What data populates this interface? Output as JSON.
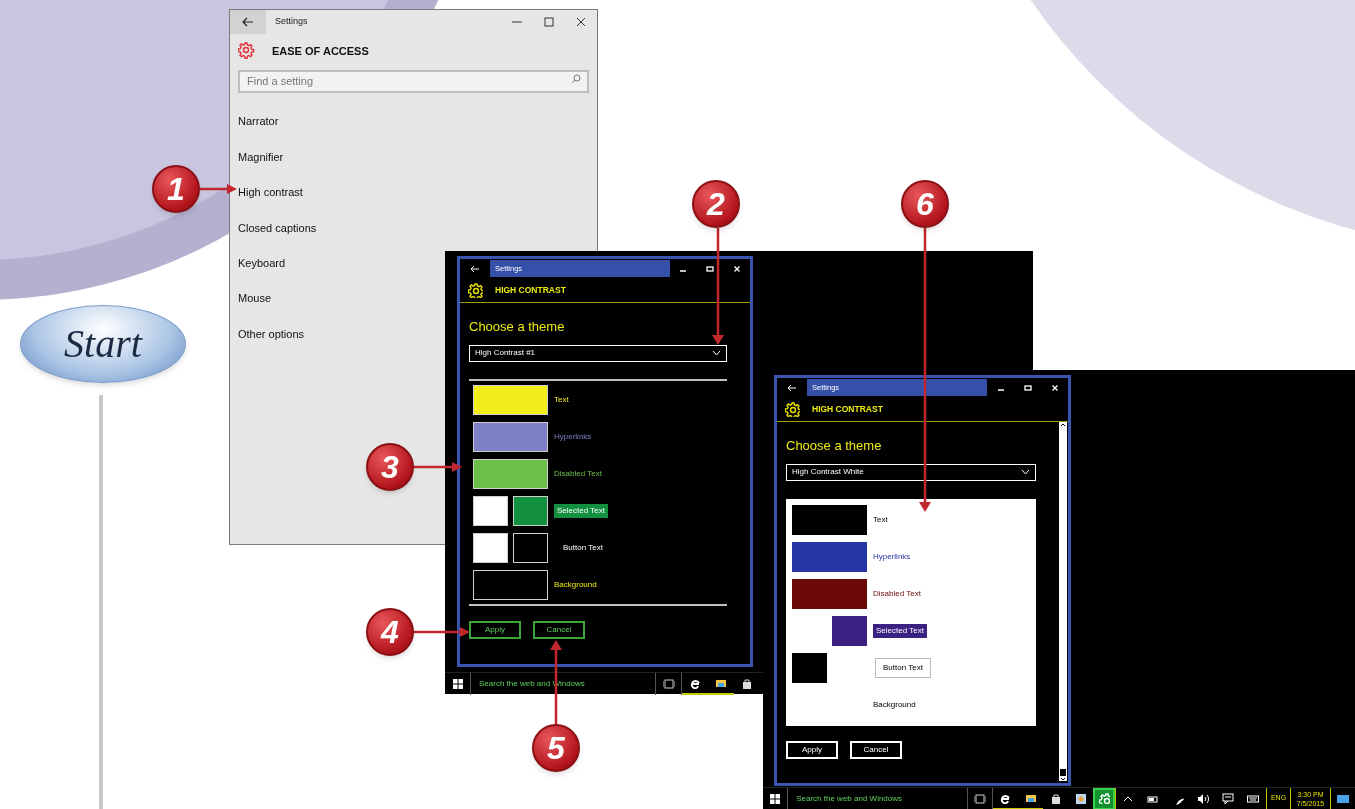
{
  "start_badge": {
    "label": "Start"
  },
  "callouts": [
    {
      "label": "1"
    },
    {
      "label": "2"
    },
    {
      "label": "3"
    },
    {
      "label": "4"
    },
    {
      "label": "5"
    },
    {
      "label": "6"
    }
  ],
  "settings_window": {
    "title": "Settings",
    "header": "EASE OF ACCESS",
    "search": {
      "placeholder": "Find a setting"
    },
    "items": [
      {
        "label": "Narrator"
      },
      {
        "label": "Magnifier"
      },
      {
        "label": "High contrast"
      },
      {
        "label": "Closed captions"
      },
      {
        "label": "Keyboard"
      },
      {
        "label": "Mouse"
      },
      {
        "label": "Other options"
      }
    ]
  },
  "screens": [
    {
      "kind": "black-panel",
      "title": "Settings",
      "header": "HIGH CONTRAST",
      "heading": "Choose a theme",
      "theme_dropdown": "High Contrast #1",
      "rows": [
        {
          "kind": "plain",
          "label": "Text",
          "swatches": [
            {
              "color": "#f2ec1c"
            }
          ]
        },
        {
          "kind": "plain",
          "label": "Hyperlinks",
          "swatches": [
            {
              "color": "#7e80c8"
            }
          ]
        },
        {
          "kind": "plain",
          "label": "Disabled Text",
          "swatches": [
            {
              "color": "#6cc04a"
            }
          ]
        },
        {
          "kind": "highlight",
          "label": "Selected Text",
          "swatches": [
            {
              "color": "#ffffff"
            },
            {
              "color": "#13903f"
            }
          ]
        },
        {
          "kind": "button",
          "label": "Button Text",
          "swatches": [
            {
              "color": "#ffffff"
            },
            {
              "color": "#000000"
            }
          ]
        },
        {
          "kind": "background",
          "label": "Background",
          "swatches": [
            {
              "color": "#000000"
            }
          ]
        }
      ],
      "buttons": [
        {
          "label": "Apply"
        },
        {
          "label": "Cancel"
        }
      ],
      "taskbar": {
        "search": "Search the web and Windows"
      }
    },
    {
      "kind": "white-panel",
      "title": "Settings",
      "header": "HIGH CONTRAST",
      "heading": "Choose a theme",
      "theme_dropdown": "High Contrast White",
      "rows": [
        {
          "kind": "plain",
          "label": "Text",
          "swatches": [
            {
              "color": "#000000"
            }
          ]
        },
        {
          "kind": "plain",
          "label": "Hyperlinks",
          "swatches": [
            {
              "color": "#2636a4"
            }
          ]
        },
        {
          "kind": "plain",
          "label": "Disabled Text",
          "swatches": [
            {
              "color": "#6c0a0a"
            }
          ]
        },
        {
          "kind": "highlight",
          "label": "Selected Text",
          "swatches": [
            {
              "color": "#3a2182"
            }
          ]
        },
        {
          "kind": "button",
          "label": "Button Text",
          "swatches": [
            {
              "color": "#000000"
            }
          ]
        },
        {
          "kind": "background",
          "label": "Background"
        }
      ],
      "buttons": [
        {
          "label": "Apply"
        },
        {
          "label": "Cancel"
        }
      ],
      "taskbar": {
        "search": "Search the web and Windows",
        "language": "ENG",
        "time": "3:30 PM",
        "date": "7/5/2015"
      }
    }
  ]
}
